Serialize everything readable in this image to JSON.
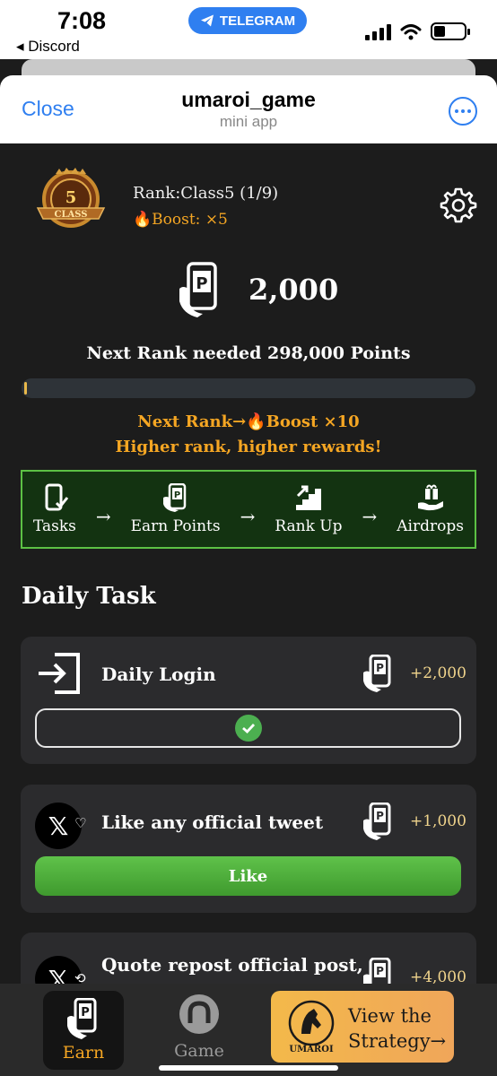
{
  "status_bar": {
    "time": "7:08",
    "back_app": "◂ Discord",
    "telegram_pill": "TELEGRAM"
  },
  "header": {
    "close_label": "Close",
    "title": "umaroi_game",
    "subtitle": "mini app"
  },
  "profile": {
    "badge_number": "5",
    "badge_text": "CLASS",
    "rank": "Rank:Class5 (1/9)",
    "boost": "🔥Boost: ×5",
    "points": "2,000",
    "next_rank_needed": "Next Rank needed 298,000 Points",
    "progress_fraction": 0.0067,
    "next_rank_boost": "Next Rank→🔥Boost ×10",
    "higher_rank": "Higher rank, higher rewards!"
  },
  "flow": {
    "steps": [
      "Tasks",
      "Earn Points",
      "Rank Up",
      "Airdrops"
    ],
    "arrow": "→"
  },
  "daily": {
    "title": "Daily Task",
    "tasks": [
      {
        "name": "Daily Login",
        "reward": "+2,000",
        "state": "done"
      },
      {
        "name": "Like any official tweet",
        "reward": "+1,000",
        "button": "Like"
      },
      {
        "name": "Quote repost official post,",
        "reward": "+4,000"
      }
    ]
  },
  "nav": {
    "earn": "Earn",
    "game": "Game",
    "strategy_line1": "View the",
    "strategy_line2": "Strategy→",
    "logo_text": "UMAROI"
  },
  "colors": {
    "accent_blue": "#2f7ff0",
    "gold": "#f5a623",
    "green": "#5cc144",
    "background": "#1c1c1c"
  }
}
